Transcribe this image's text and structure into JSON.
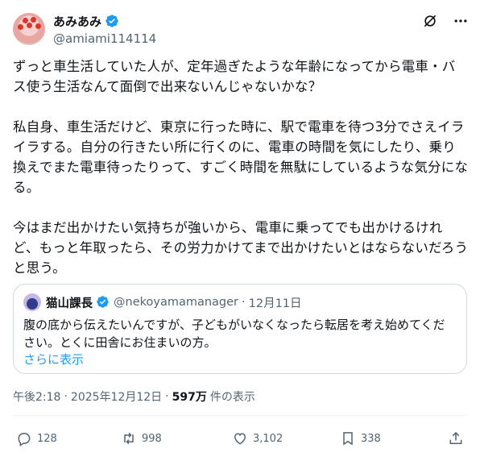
{
  "author": {
    "display_name": "あみあみ",
    "handle": "@amiami114114"
  },
  "icons": {
    "verified": "verified-badge-icon",
    "grok": "grok-icon",
    "more": "more-icon"
  },
  "colors": {
    "verified": "#1d9bf0",
    "link": "#1d9bf0",
    "muted": "#536471"
  },
  "tweet": {
    "paragraphs": [
      "ずっと車生活していた人が、定年過ぎたような年齢になってから電車・バス使う生活なんて面倒で出来ないんじゃないかな？",
      "私自身、車生活だけど、東京に行った時に、駅で電車を待つ3分でさえイライラする。自分の行きたい所に行くのに、電車の時間を気にしたり、乗り換えでまた電車待ったりって、すごく時間を無駄にしているような気分になる。",
      "今はまだ出かけたい気持ちが強いから、電車に乗ってでも出かけるけれど、もっと年取ったら、その労力かけてまで出かけたいとはならないだろうと思う。"
    ]
  },
  "quote": {
    "display_name": "猫山課長",
    "handle": "@nekoyamamanager",
    "dot": "·",
    "date": "12月11日",
    "text": "腹の底から伝えたいんですが、子どもがいなくなったら転居を考え始めてください。とくに田舎にお住まいの方。",
    "show_more": "さらに表示"
  },
  "meta": {
    "time": "午後2:18",
    "dot": "·",
    "date": "2025年12月12日",
    "dot2": "·",
    "views": "597万",
    "views_label": "件の表示"
  },
  "actions": {
    "replies": "128",
    "retweets": "998",
    "likes": "3,102",
    "bookmarks": "338"
  }
}
